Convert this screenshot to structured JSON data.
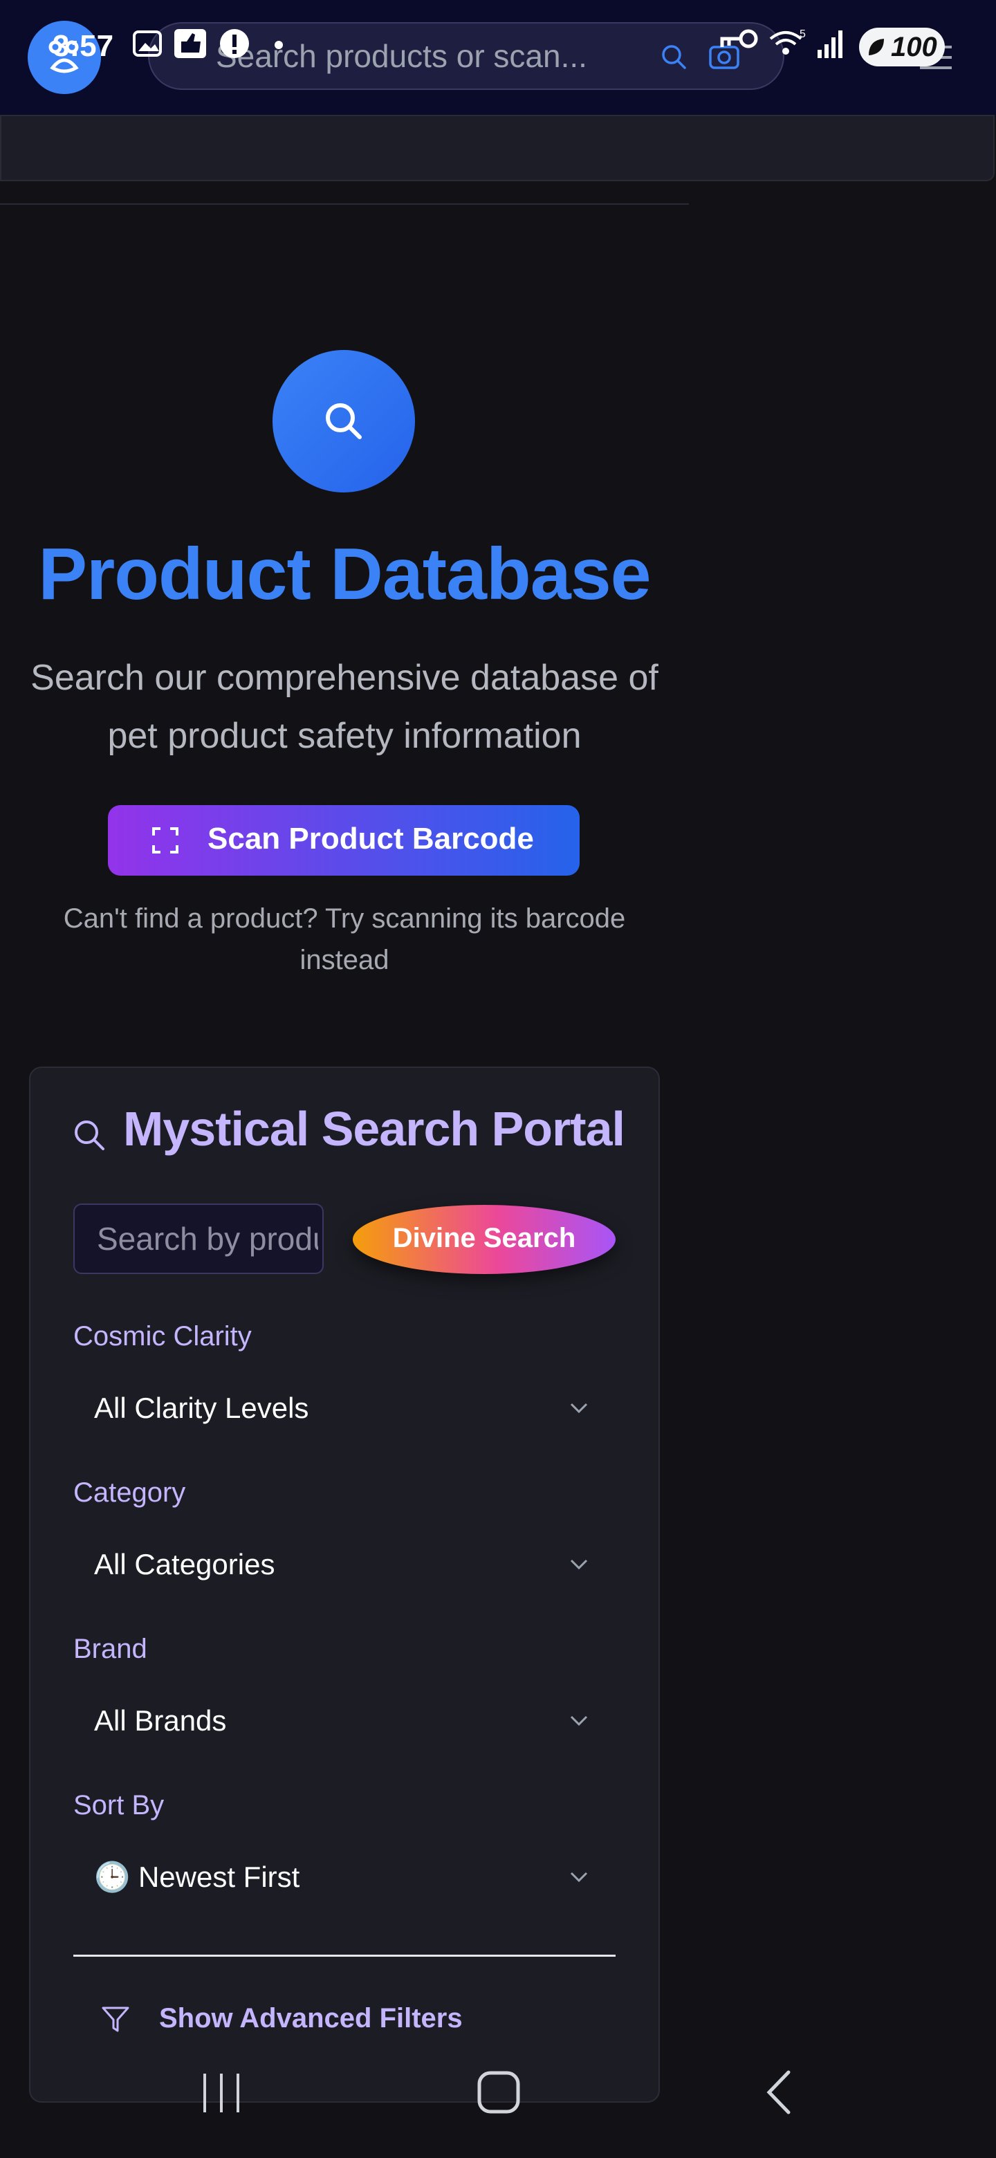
{
  "status_bar": {
    "time": "3:57",
    "battery": "100"
  },
  "header": {
    "search_placeholder": "Search products or scan..."
  },
  "hero": {
    "title": "Product Database",
    "subtitle": "Search our comprehensive database of pet product safety information",
    "scan_button": "Scan Product Barcode",
    "hint": "Can't find a product? Try scanning its barcode instead"
  },
  "search_portal": {
    "title": "Mystical Search Portal",
    "search_placeholder": "Search by product",
    "search_button": "Divine Search",
    "filters": [
      {
        "label": "Cosmic Clarity",
        "value": "All Clarity Levels"
      },
      {
        "label": "Category",
        "value": "All Categories"
      },
      {
        "label": "Brand",
        "value": "All Brands"
      },
      {
        "label": "Sort By",
        "value": "🕒 Newest First"
      }
    ],
    "advanced_toggle": "Show Advanced Filters"
  },
  "colors": {
    "accent": "#3b82f6",
    "purple": "#c4b5fd",
    "background": "#121216"
  }
}
